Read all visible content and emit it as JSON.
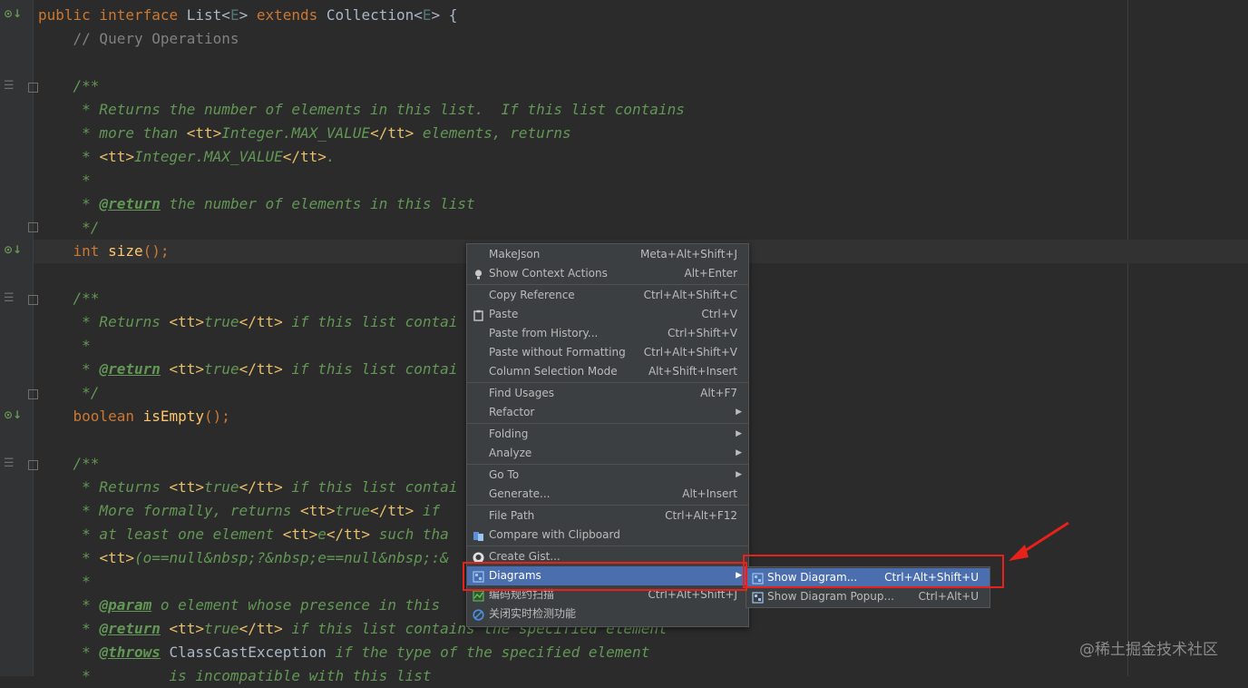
{
  "editor": {
    "lines": [
      [
        {
          "t": "public interface ",
          "c": "kw"
        },
        {
          "t": "List",
          "c": "pn"
        },
        {
          "t": "<",
          "c": "pn"
        },
        {
          "t": "E",
          "c": "tp"
        },
        {
          "t": "> ",
          "c": "pn"
        },
        {
          "t": "extends ",
          "c": "kw"
        },
        {
          "t": "Collection",
          "c": "pn"
        },
        {
          "t": "<",
          "c": "pn"
        },
        {
          "t": "E",
          "c": "tp"
        },
        {
          "t": "> {",
          "c": "pn"
        }
      ],
      [
        {
          "t": "    // Query Operations",
          "c": "cm"
        }
      ],
      [],
      [
        {
          "t": "    /**",
          "c": "doc"
        }
      ],
      [
        {
          "t": "     * Returns the number of elements in this list.  If this list contains",
          "c": "doc"
        }
      ],
      [
        {
          "t": "     * more than ",
          "c": "doc"
        },
        {
          "t": "<tt>",
          "c": "ht"
        },
        {
          "t": "Integer.MAX_VALUE",
          "c": "doc"
        },
        {
          "t": "</tt>",
          "c": "ht"
        },
        {
          "t": " elements, returns",
          "c": "doc"
        }
      ],
      [
        {
          "t": "     * ",
          "c": "doc"
        },
        {
          "t": "<tt>",
          "c": "ht"
        },
        {
          "t": "Integer.MAX_VALUE",
          "c": "doc"
        },
        {
          "t": "</tt>",
          "c": "ht"
        },
        {
          "t": ".",
          "c": "doc"
        }
      ],
      [
        {
          "t": "     *",
          "c": "doc"
        }
      ],
      [
        {
          "t": "     * ",
          "c": "doc"
        },
        {
          "t": "@return",
          "c": "tag"
        },
        {
          "t": " the number of elements in this list",
          "c": "doc"
        }
      ],
      [
        {
          "t": "     */",
          "c": "doc"
        }
      ],
      [
        {
          "t": "    int ",
          "c": "kw"
        },
        {
          "t": "size",
          "c": "fn"
        },
        {
          "t": "();",
          "c": "kw"
        }
      ],
      [],
      [
        {
          "t": "    /**",
          "c": "doc"
        }
      ],
      [
        {
          "t": "     * Returns ",
          "c": "doc"
        },
        {
          "t": "<tt>",
          "c": "ht"
        },
        {
          "t": "true",
          "c": "doc"
        },
        {
          "t": "</tt>",
          "c": "ht"
        },
        {
          "t": " if this list contai",
          "c": "doc"
        }
      ],
      [
        {
          "t": "     *",
          "c": "doc"
        }
      ],
      [
        {
          "t": "     * ",
          "c": "doc"
        },
        {
          "t": "@return",
          "c": "tag"
        },
        {
          "t": " ",
          "c": "doc"
        },
        {
          "t": "<tt>",
          "c": "ht"
        },
        {
          "t": "true",
          "c": "doc"
        },
        {
          "t": "</tt>",
          "c": "ht"
        },
        {
          "t": " if this list contai",
          "c": "doc"
        }
      ],
      [
        {
          "t": "     */",
          "c": "doc"
        }
      ],
      [
        {
          "t": "    boolean ",
          "c": "kw"
        },
        {
          "t": "isEmpty",
          "c": "fn"
        },
        {
          "t": "();",
          "c": "kw"
        }
      ],
      [],
      [
        {
          "t": "    /**",
          "c": "doc"
        }
      ],
      [
        {
          "t": "     * Returns ",
          "c": "doc"
        },
        {
          "t": "<tt>",
          "c": "ht"
        },
        {
          "t": "true",
          "c": "doc"
        },
        {
          "t": "</tt>",
          "c": "ht"
        },
        {
          "t": " if this list contai",
          "c": "doc"
        }
      ],
      [
        {
          "t": "     * More formally, returns ",
          "c": "doc"
        },
        {
          "t": "<tt>",
          "c": "ht"
        },
        {
          "t": "true",
          "c": "doc"
        },
        {
          "t": "</tt>",
          "c": "ht"
        },
        {
          "t": " if",
          "c": "doc"
        }
      ],
      [
        {
          "t": "     * at least one element ",
          "c": "doc"
        },
        {
          "t": "<tt>",
          "c": "ht"
        },
        {
          "t": "e",
          "c": "doc"
        },
        {
          "t": "</tt>",
          "c": "ht"
        },
        {
          "t": " such tha",
          "c": "doc"
        }
      ],
      [
        {
          "t": "     * ",
          "c": "doc"
        },
        {
          "t": "<tt>",
          "c": "ht"
        },
        {
          "t": "(o==null&nbsp;?&nbsp;e==null&nbsp;:&",
          "c": "doc"
        }
      ],
      [
        {
          "t": "     *",
          "c": "doc"
        }
      ],
      [
        {
          "t": "     * ",
          "c": "doc"
        },
        {
          "t": "@param",
          "c": "tag"
        },
        {
          "t": " o element whose presence in this",
          "c": "doc"
        }
      ],
      [
        {
          "t": "     * ",
          "c": "doc"
        },
        {
          "t": "@return",
          "c": "tag"
        },
        {
          "t": " ",
          "c": "doc"
        },
        {
          "t": "<tt>",
          "c": "ht"
        },
        {
          "t": "true",
          "c": "doc"
        },
        {
          "t": "</tt>",
          "c": "ht"
        },
        {
          "t": " if this list contains the specified element",
          "c": "doc"
        }
      ],
      [
        {
          "t": "     * ",
          "c": "doc"
        },
        {
          "t": "@throws",
          "c": "tag"
        },
        {
          "t": " ",
          "c": "doc"
        },
        {
          "t": "ClassCastException",
          "c": "pn"
        },
        {
          "t": " if the type of the specified element",
          "c": "doc"
        }
      ],
      [
        {
          "t": "     *         is incompatible with this list",
          "c": "doc"
        }
      ]
    ]
  },
  "context_menu": {
    "items": [
      {
        "label": "MakeJson",
        "shortcut": "Meta+Alt+Shift+J"
      },
      {
        "label": "Show Context Actions",
        "shortcut": "Alt+Enter",
        "icon": "lightbulb-icon"
      },
      {
        "label": "Copy Reference",
        "shortcut": "Ctrl+Alt+Shift+C",
        "sep_before": true
      },
      {
        "label": "Paste",
        "shortcut": "Ctrl+V",
        "icon": "clipboard-icon"
      },
      {
        "label": "Paste from History...",
        "shortcut": "Ctrl+Shift+V"
      },
      {
        "label": "Paste without Formatting",
        "shortcut": "Ctrl+Alt+Shift+V"
      },
      {
        "label": "Column Selection Mode",
        "shortcut": "Alt+Shift+Insert"
      },
      {
        "label": "Find Usages",
        "shortcut": "Alt+F7",
        "sep_before": true
      },
      {
        "label": "Refactor",
        "shortcut": "",
        "submenu": true
      },
      {
        "label": "Folding",
        "shortcut": "",
        "submenu": true,
        "sep_before": true
      },
      {
        "label": "Analyze",
        "shortcut": "",
        "submenu": true
      },
      {
        "label": "Go To",
        "shortcut": "",
        "submenu": true,
        "sep_before": true
      },
      {
        "label": "Generate...",
        "shortcut": "Alt+Insert"
      },
      {
        "label": "File Path",
        "shortcut": "Ctrl+Alt+F12",
        "sep_before": true
      },
      {
        "label": "Compare with Clipboard",
        "shortcut": "",
        "icon": "compare-icon"
      },
      {
        "label": "Create Gist...",
        "shortcut": "",
        "icon": "github-icon",
        "sep_before": true
      },
      {
        "label": "Diagrams",
        "shortcut": "",
        "submenu": true,
        "selected": true,
        "icon": "diagram-icon"
      },
      {
        "label": "编码规约扫描",
        "shortcut": "Ctrl+Alt+Shift+J",
        "icon": "scan-icon"
      },
      {
        "label": "关闭实时检测功能",
        "shortcut": "",
        "icon": "disable-icon"
      }
    ]
  },
  "diagrams_submenu": {
    "items": [
      {
        "label": "Show Diagram...",
        "shortcut": "Ctrl+Alt+Shift+U",
        "selected": true
      },
      {
        "label": "Show Diagram Popup...",
        "shortcut": "Ctrl+Alt+U"
      }
    ]
  },
  "watermark": "@稀土掘金技术社区",
  "colors": {
    "accent": "#4b6eaf",
    "highlight_box": "#e8211b",
    "background": "#2b2b2b"
  }
}
